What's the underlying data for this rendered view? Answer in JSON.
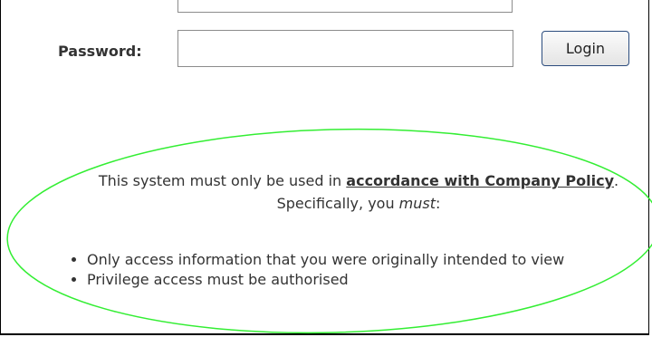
{
  "login": {
    "password_label": "Password:",
    "password_value": "",
    "login_button": "Login"
  },
  "policy": {
    "intro_before": "This system must only be used in ",
    "link_text": "accordance with Company Policy",
    "intro_after": ".  Specifically, you ",
    "emphasis": "must",
    "intro_end": ":"
  },
  "rules": [
    "Only access information that you were originally intended to view",
    "Privilege access must be authorised"
  ],
  "colors": {
    "annotation_ellipse": "#33ee33",
    "text": "#333333",
    "button_border": "#2b4c7e"
  }
}
